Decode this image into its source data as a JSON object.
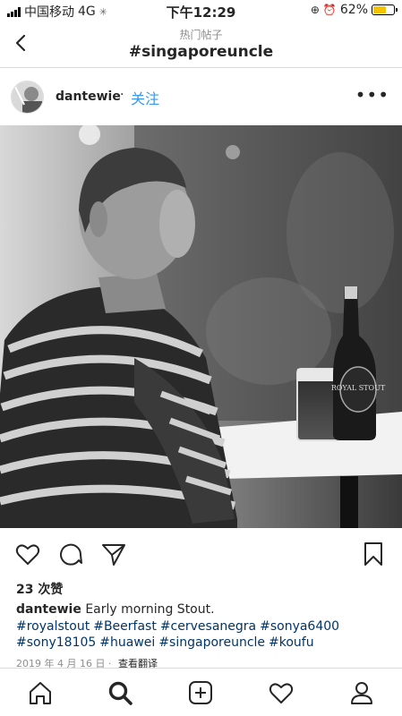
{
  "status_bar": {
    "carrier": "中国移动",
    "network": "4G",
    "time": "下午12:29",
    "battery": "62%",
    "battery_fraction": 0.62,
    "battery_color": "#f4c400"
  },
  "nav": {
    "subtitle": "热门帖子",
    "title": "#singaporeuncle",
    "back_icon": "chevron-left-icon"
  },
  "post": {
    "username": "dantewie",
    "separator": "·",
    "follow_label": "关注",
    "more_icon": "more-horizontal-icon",
    "likes": "23 次赞",
    "caption_user": "dantewie",
    "caption_text": "Early morning Stout.",
    "hashtags": [
      "#royalstout",
      "#Beerfast",
      "#cervesanegra",
      "#sonya6400",
      "#sony18105",
      "#huawei",
      "#singaporeuncle",
      "#koufu"
    ],
    "date": "2019 年 4 月 16 日",
    "date_separator": "·",
    "translate_label": "查看翻译",
    "bottle_label": "ROYAL STOUT"
  },
  "actions": [
    "heart-icon",
    "comment-icon",
    "share-icon",
    "bookmark-icon"
  ],
  "tabbar": [
    "home-icon",
    "search-icon",
    "add-icon",
    "activity-heart-icon",
    "profile-icon"
  ],
  "colors": {
    "link": "#3897f0",
    "hashtag": "#003569",
    "divider": "#dbdbdb"
  }
}
